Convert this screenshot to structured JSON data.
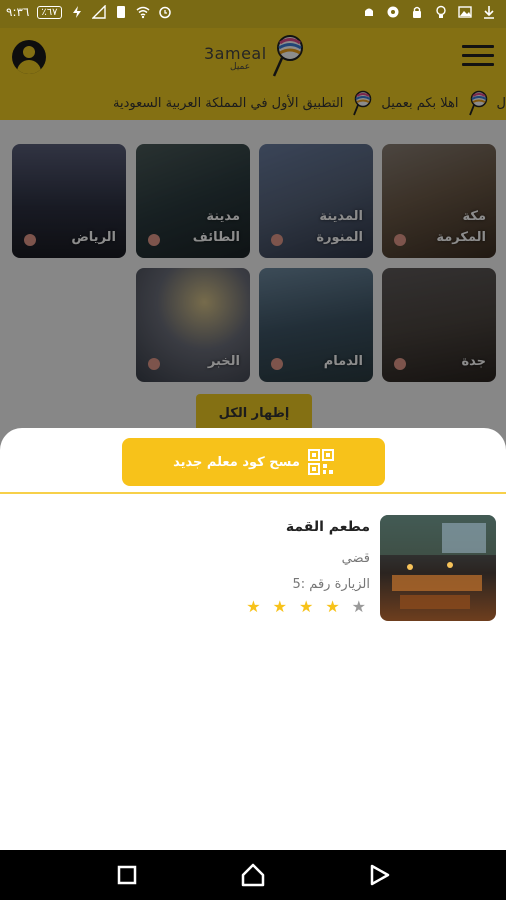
{
  "status_bar": {
    "time": "٩:٣٦",
    "battery": "٪٦٧"
  },
  "app_bar": {
    "logo_word": "3ameal",
    "logo_sub": "عميل"
  },
  "marquee": {
    "message_1": "اهلا بكم بعميل",
    "message_2": "التطبيق الأول في المملكة العربية السعودية"
  },
  "cities": [
    {
      "name": "مكة\nالمكرمة",
      "bg": "#6c5a48"
    },
    {
      "name": "المدينة\nالمنورة",
      "bg": "#56637a"
    },
    {
      "name": "مدينة\nالطائف",
      "bg": "#2b3b3f"
    },
    {
      "name": "الرياض",
      "bg": "#2d3142"
    },
    {
      "name": "جدة",
      "bg": "#4c4540"
    },
    {
      "name": "الدمام",
      "bg": "#3e5566"
    },
    {
      "name": "الخبر",
      "bg": "#4c5361"
    }
  ],
  "show_all_label": "إظهار الكل",
  "sheet": {
    "scan_label": "مسح كود معلم جديد",
    "restaurant": {
      "name": "مطعم القمة",
      "city": "قضي",
      "visit": "الزيارة رقم :5",
      "rating": 4,
      "max_rating": 5
    }
  },
  "colors": {
    "brand": "#f1cd24",
    "button": "#f7c21a",
    "star_on": "#f7c21a",
    "star_off": "#9a9a9a"
  }
}
